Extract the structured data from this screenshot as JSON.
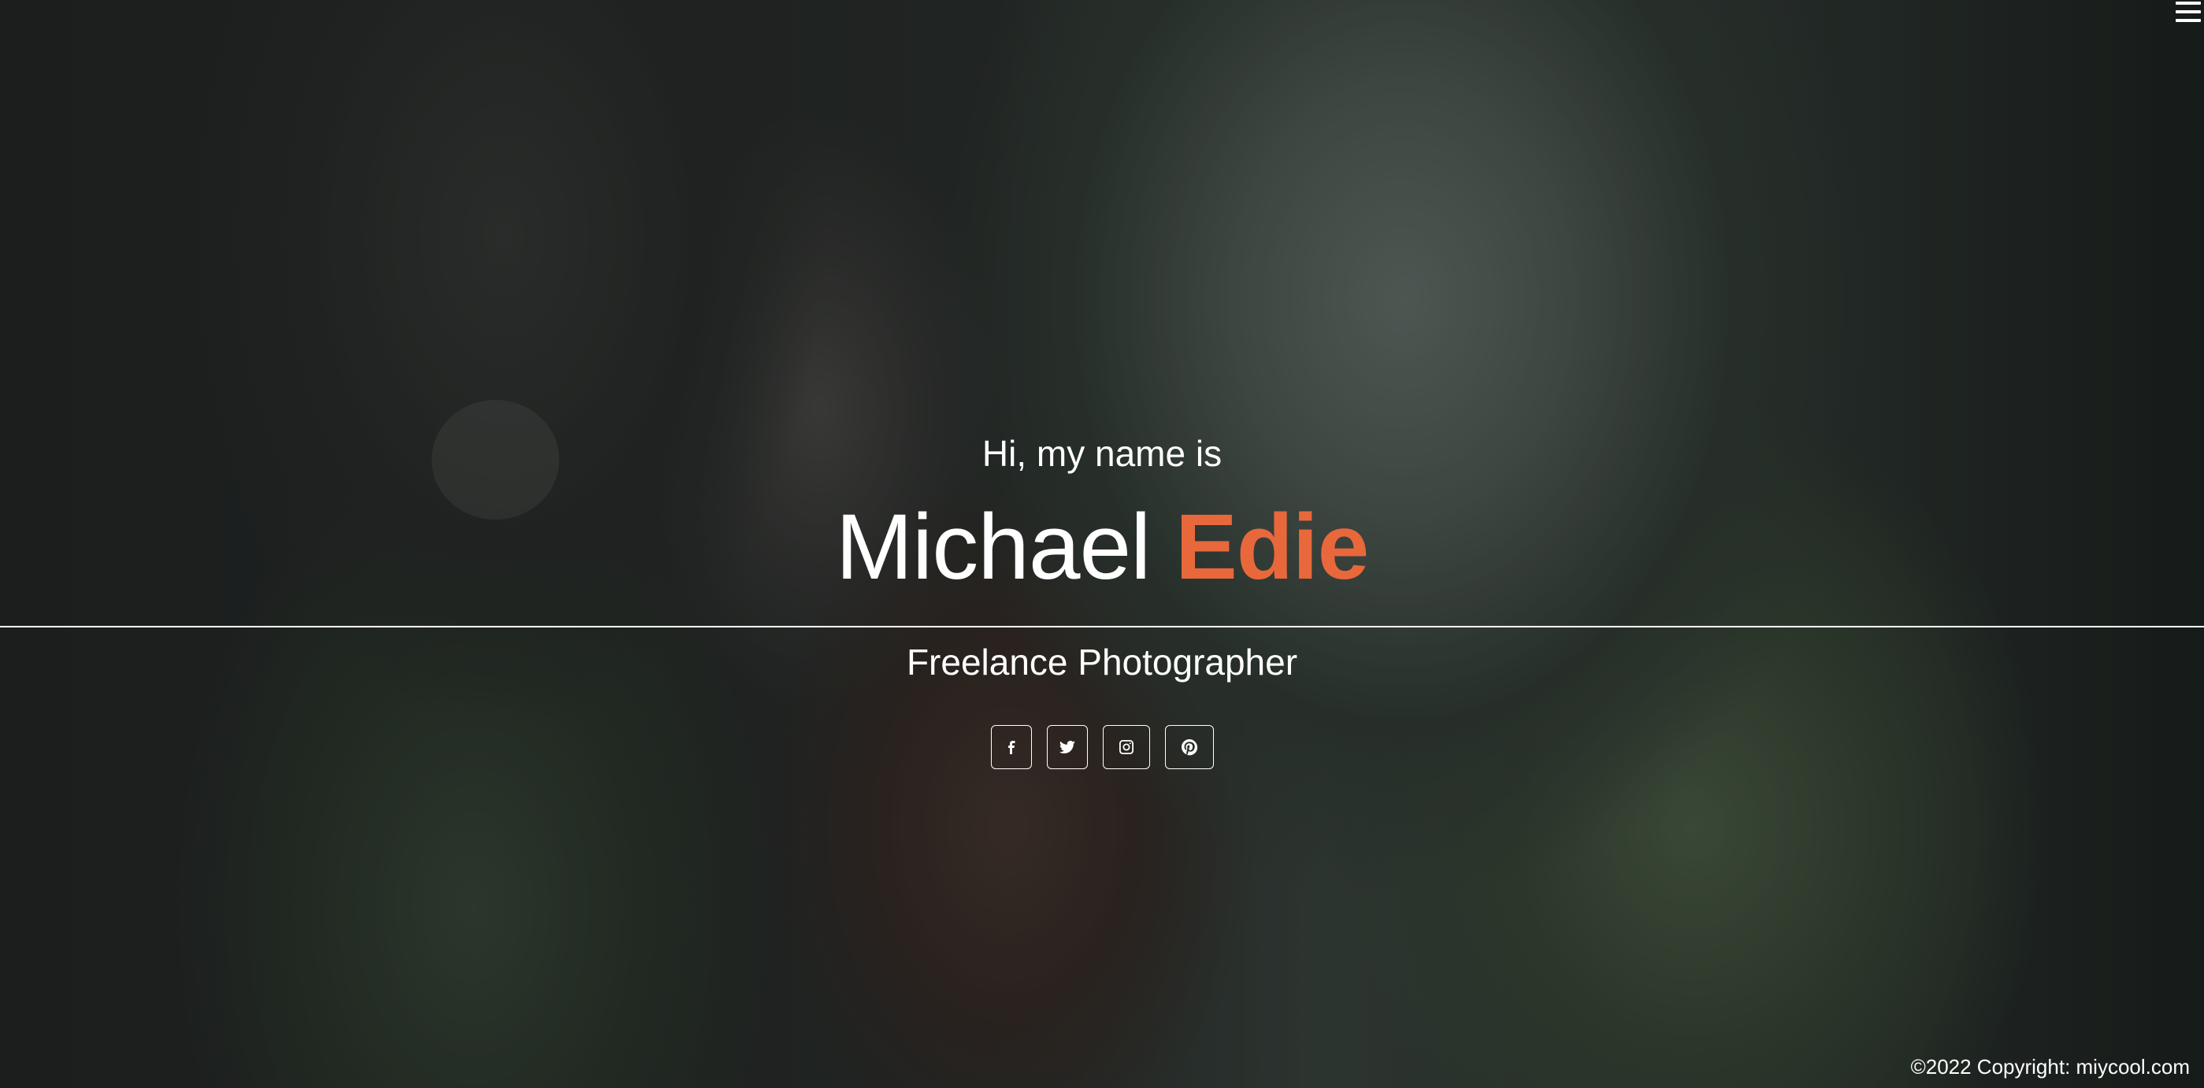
{
  "menu": {
    "icon": "hamburger-menu-icon"
  },
  "hero": {
    "greeting": "Hi, my name is",
    "first_name": "Michael",
    "last_name": "Edie",
    "subtitle": "Freelance Photographer"
  },
  "social": [
    {
      "icon": "facebook-icon"
    },
    {
      "icon": "twitter-icon"
    },
    {
      "icon": "instagram-icon"
    },
    {
      "icon": "pinterest-icon"
    }
  ],
  "footer": {
    "copyright": "©2022 Copyright: miycool.com"
  },
  "colors": {
    "accent": "#e8683c",
    "text": "#ffffff"
  }
}
